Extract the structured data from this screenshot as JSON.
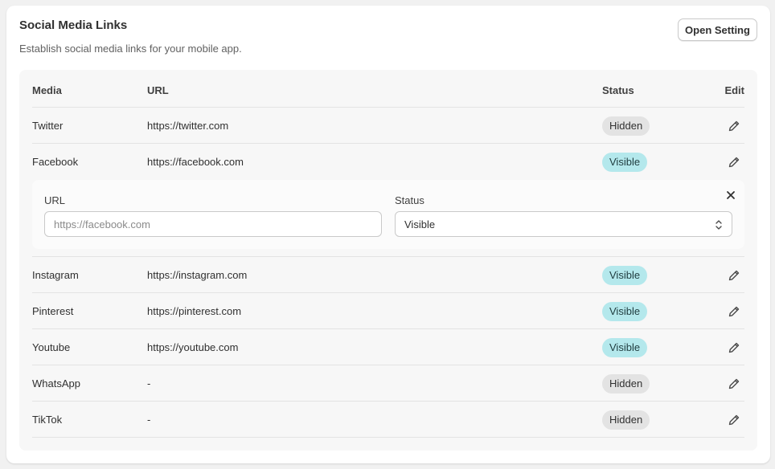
{
  "header": {
    "title": "Social Media Links",
    "subtitle": "Establish social media links for your mobile app.",
    "open_setting_label": "Open Setting"
  },
  "table": {
    "columns": {
      "media": "Media",
      "url": "URL",
      "status": "Status",
      "edit": "Edit"
    },
    "rows": [
      {
        "media": "Twitter",
        "url": "https://twitter.com",
        "status": "Hidden"
      },
      {
        "media": "Facebook",
        "url": "https://facebook.com",
        "status": "Visible"
      },
      {
        "media": "Instagram",
        "url": "https://instagram.com",
        "status": "Visible"
      },
      {
        "media": "Pinterest",
        "url": "https://pinterest.com",
        "status": "Visible"
      },
      {
        "media": "Youtube",
        "url": "https://youtube.com",
        "status": "Visible"
      },
      {
        "media": "WhatsApp",
        "url": "-",
        "status": "Hidden"
      },
      {
        "media": "TikTok",
        "url": "-",
        "status": "Hidden"
      }
    ]
  },
  "edit_form": {
    "url_label": "URL",
    "url_placeholder": "https://facebook.com",
    "status_label": "Status",
    "status_value": "Visible"
  },
  "colors": {
    "badge_visible": "#b4e8ec",
    "badge_hidden": "#e3e3e3"
  },
  "icons": {
    "edit": "pencil-icon",
    "close": "close-icon",
    "select": "chevron-up-down-icon"
  }
}
